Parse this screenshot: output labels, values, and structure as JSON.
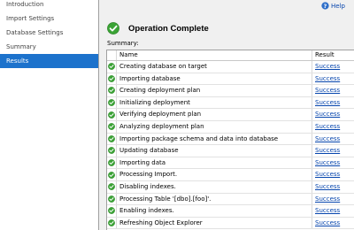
{
  "sidebar": {
    "items": [
      {
        "label": "Introduction",
        "selected": false
      },
      {
        "label": "Import Settings",
        "selected": false
      },
      {
        "label": "Database Settings",
        "selected": false
      },
      {
        "label": "Summary",
        "selected": false
      },
      {
        "label": "Results",
        "selected": true
      }
    ]
  },
  "help": {
    "label": "Help",
    "icon": "help-icon"
  },
  "main": {
    "title": "Operation Complete",
    "title_icon": "success-check-icon",
    "summary_label": "Summary:",
    "columns": {
      "name": "Name",
      "result": "Result"
    },
    "rows": [
      {
        "name": "Creating database on target",
        "result": "Success"
      },
      {
        "name": "Importing database",
        "result": "Success"
      },
      {
        "name": "Creating deployment plan",
        "result": "Success"
      },
      {
        "name": "Initializing deployment",
        "result": "Success"
      },
      {
        "name": "Verifying deployment plan",
        "result": "Success"
      },
      {
        "name": "Analyzing deployment plan",
        "result": "Success"
      },
      {
        "name": "Importing package schema and data into database",
        "result": "Success"
      },
      {
        "name": "Updating database",
        "result": "Success"
      },
      {
        "name": "Importing data",
        "result": "Success"
      },
      {
        "name": "Processing Import.",
        "result": "Success"
      },
      {
        "name": "Disabling indexes.",
        "result": "Success"
      },
      {
        "name": "Processing Table '[dbo].[foo]'.",
        "result": "Success"
      },
      {
        "name": "Enabling indexes.",
        "result": "Success"
      },
      {
        "name": "Refreshing Object Explorer",
        "result": "Success"
      }
    ]
  },
  "colors": {
    "selected_bg": "#1c72cc",
    "link": "#0645ad",
    "success_green": "#3aa335"
  }
}
